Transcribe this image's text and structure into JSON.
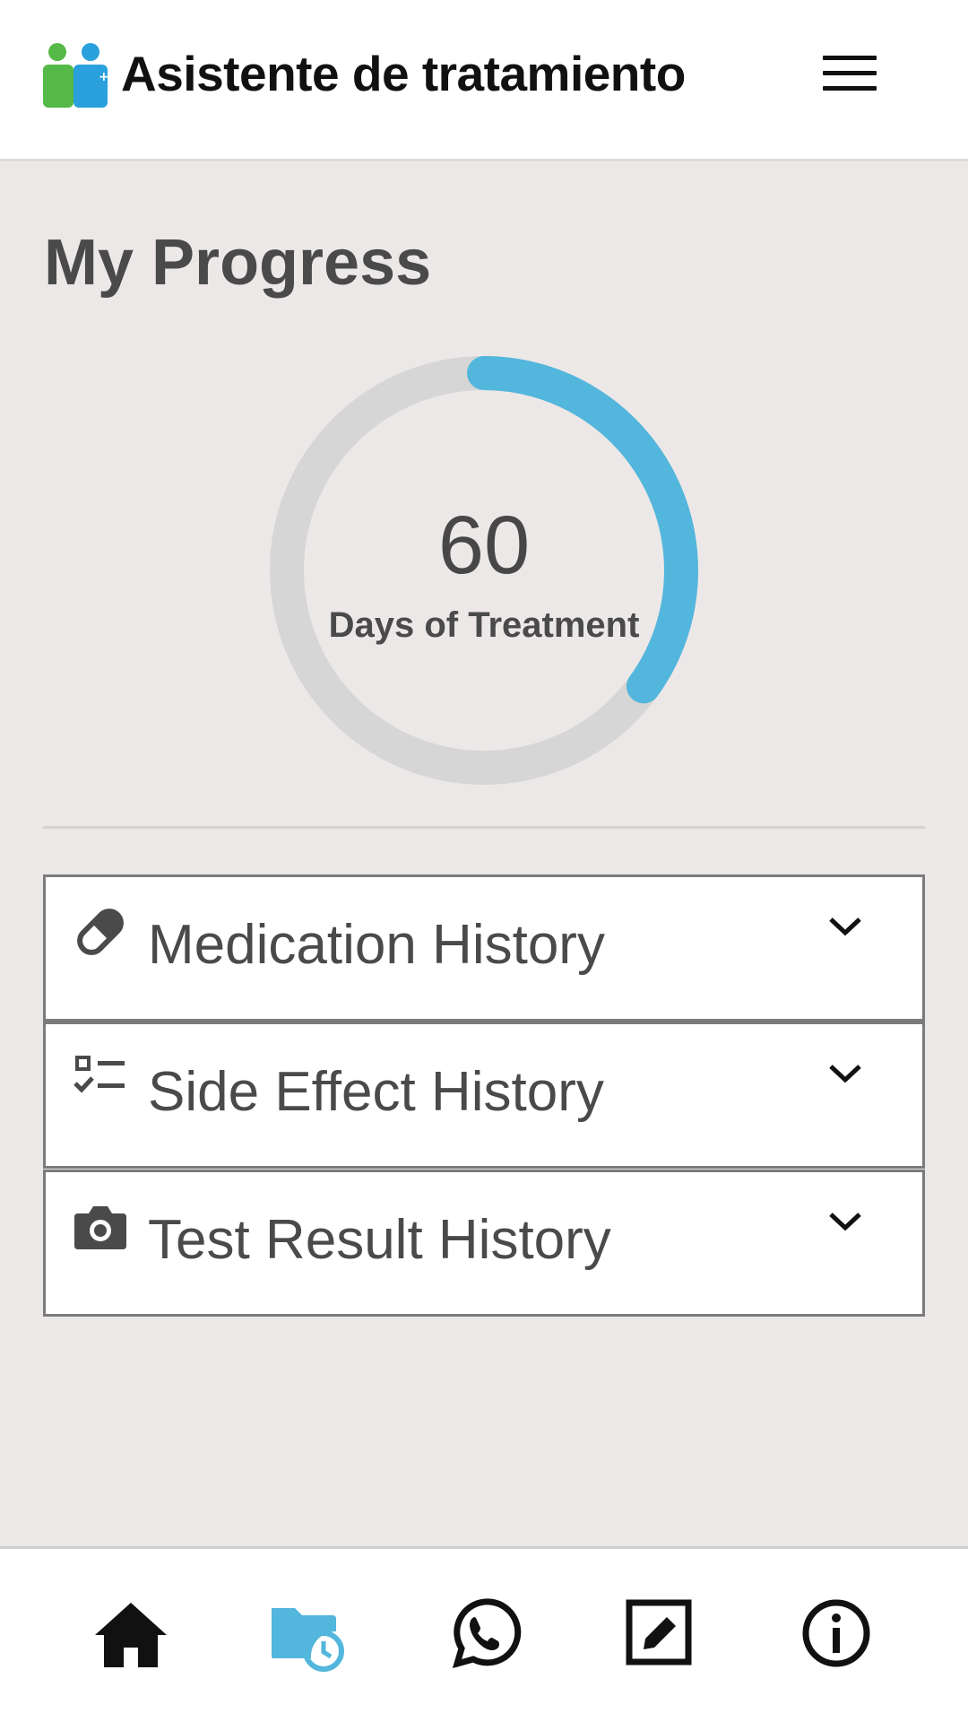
{
  "header": {
    "app_title": "Asistente de tratamiento",
    "logo_icon": "people-medical-logo",
    "menu_icon": "hamburger-menu-icon"
  },
  "page": {
    "title": "My Progress"
  },
  "progress": {
    "value": "60",
    "label": "Days of Treatment",
    "fraction": 0.35,
    "track_color": "#d6d6d6",
    "fill_color": "#53b6dc"
  },
  "history_sections": [
    {
      "label": "Medication History",
      "icon": "pill-icon"
    },
    {
      "label": "Side Effect History",
      "icon": "checklist-icon"
    },
    {
      "label": "Test Result History",
      "icon": "camera-icon"
    }
  ],
  "bottom_nav": {
    "items": [
      {
        "icon": "home-icon",
        "active": false
      },
      {
        "icon": "history-folder-icon",
        "active": true
      },
      {
        "icon": "whatsapp-icon",
        "active": false
      },
      {
        "icon": "edit-icon",
        "active": false
      },
      {
        "icon": "info-icon",
        "active": false
      }
    ],
    "active_color": "#53b6dc",
    "inactive_color": "#111111"
  }
}
